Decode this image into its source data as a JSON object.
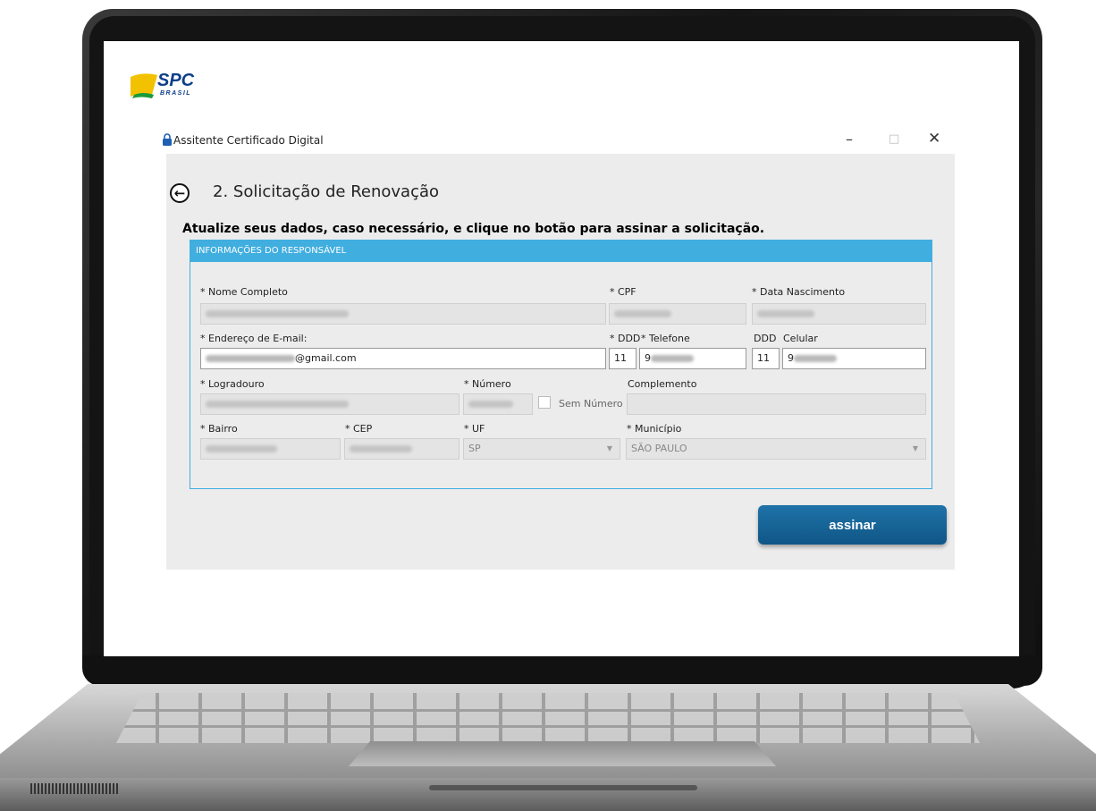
{
  "brand": {
    "logo_text": "SPC",
    "logo_subtext": "BRASIL"
  },
  "window": {
    "title": "Assitente Certificado Digital",
    "minimize": "–",
    "maximize": "□",
    "close": "✕"
  },
  "page": {
    "back_icon": "arrow-left-circle-icon",
    "step_title": "2. Solicitação de Renovação",
    "instruction": "Atualize seus dados, caso necessário, e clique no botão para assinar a solicitação."
  },
  "section": {
    "header": "INFORMAÇÕES DO RESPONSÁVEL",
    "labels": {
      "nome": "* Nome Completo",
      "cpf": "* CPF",
      "nascimento": "* Data Nascimento",
      "email": "* Endereço de E-mail:",
      "ddd_tel": "* DDD",
      "telefone": "* Telefone",
      "ddd_cel": "DDD",
      "celular": "Celular",
      "logradouro": "* Logradouro",
      "numero": "* Número",
      "sem_numero": "Sem Número",
      "complemento": "Complemento",
      "bairro": "* Bairro",
      "cep": "* CEP",
      "uf": "* UF",
      "municipio": "* Município"
    },
    "values": {
      "email_suffix": "@gmail.com",
      "ddd_tel": "11",
      "telefone_prefix": "9",
      "ddd_cel": "11",
      "celular_prefix": "9",
      "uf": "SP",
      "municipio": "SÃO PAULO"
    }
  },
  "actions": {
    "assinar": "assinar"
  },
  "colors": {
    "accent": "#41aee0",
    "button": "#0f5686",
    "panel": "#ececec"
  }
}
